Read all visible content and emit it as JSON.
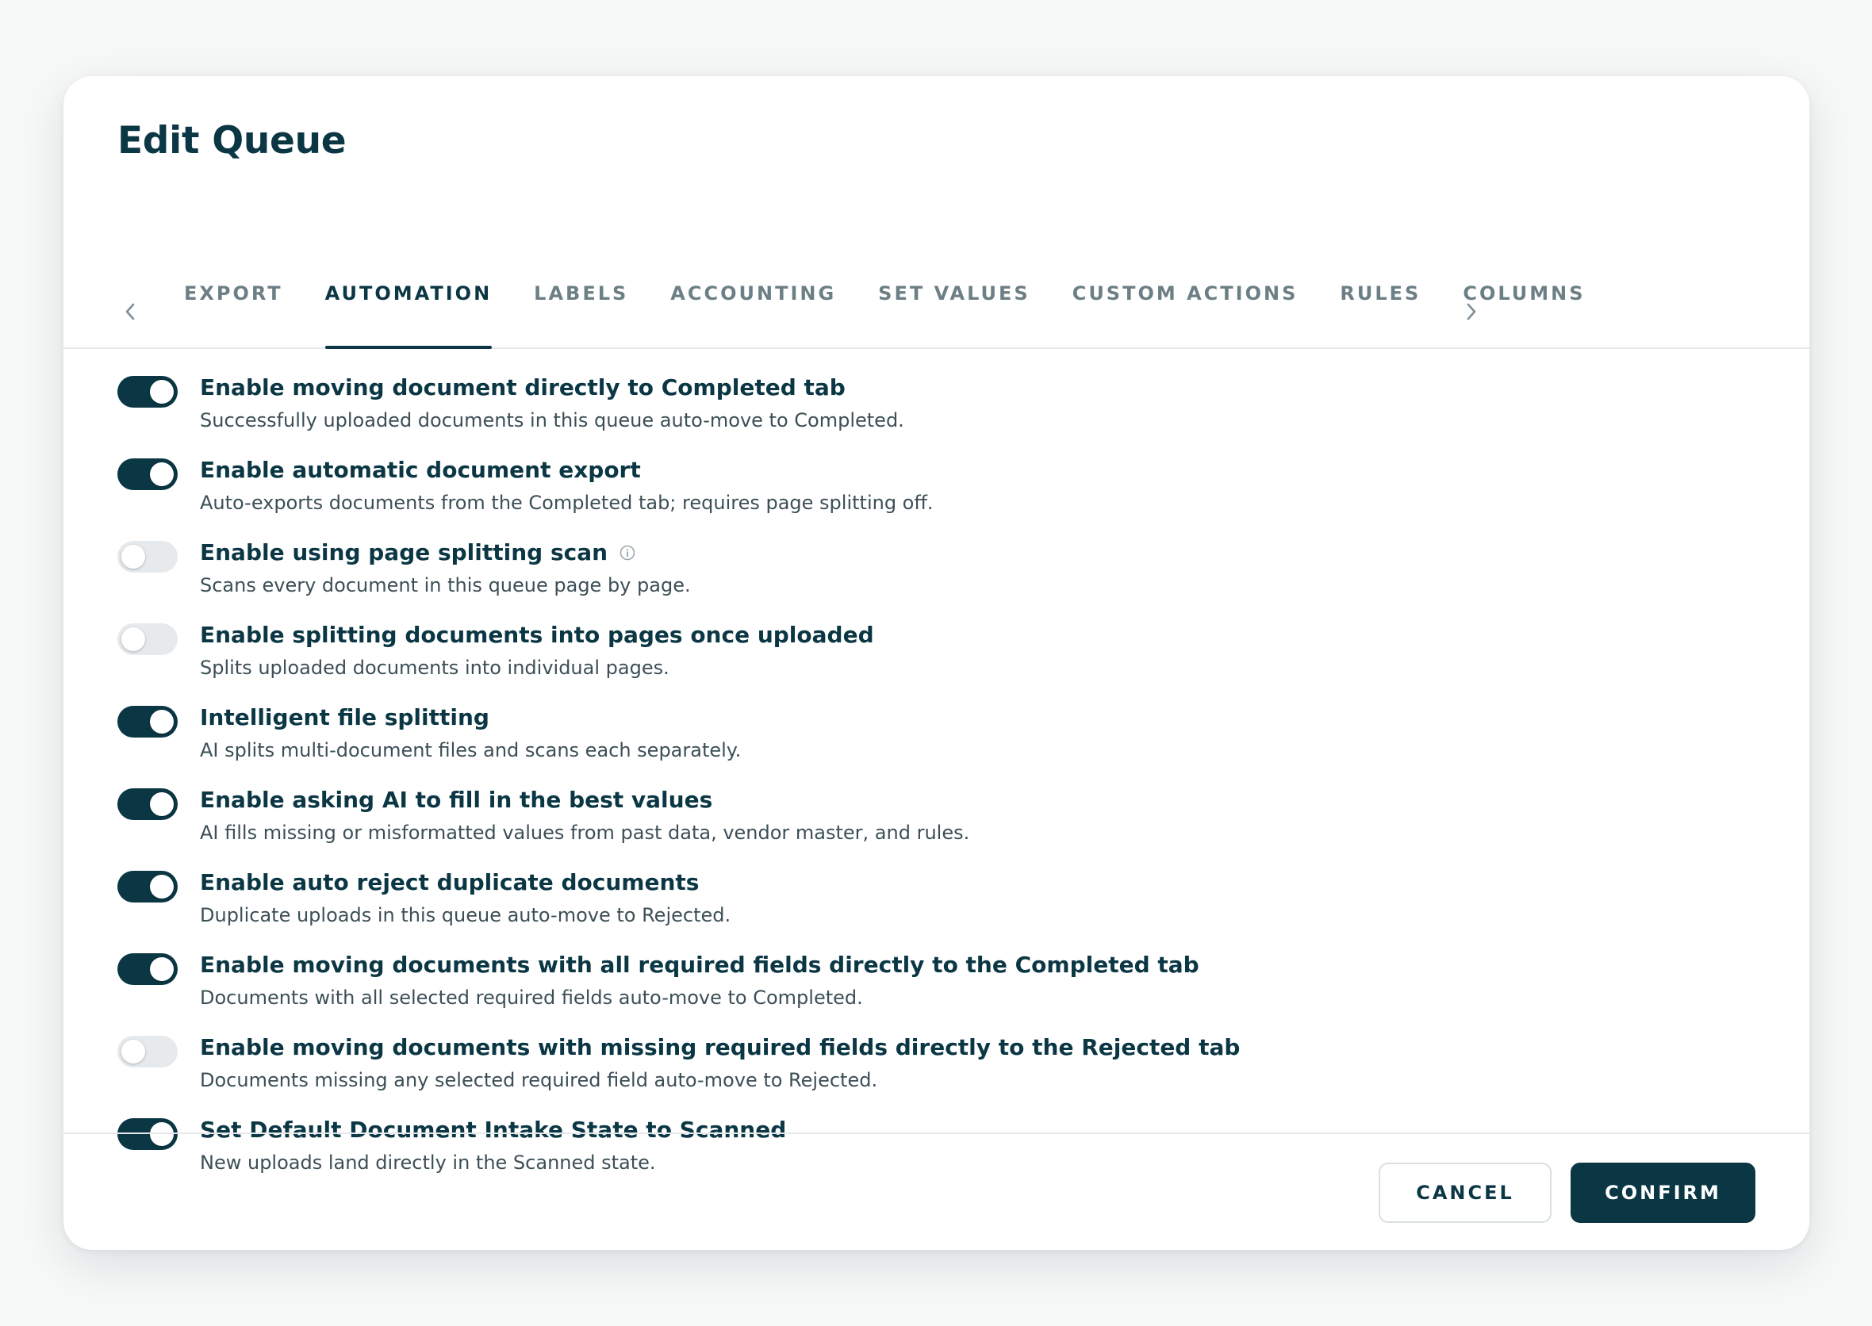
{
  "dialog": {
    "title": "Edit Queue"
  },
  "tabs": [
    {
      "label": "EXPORT",
      "active": false
    },
    {
      "label": "AUTOMATION",
      "active": true
    },
    {
      "label": "LABELS",
      "active": false
    },
    {
      "label": "ACCOUNTING",
      "active": false
    },
    {
      "label": "SET VALUES",
      "active": false
    },
    {
      "label": "CUSTOM ACTIONS",
      "active": false
    },
    {
      "label": "RULES",
      "active": false
    },
    {
      "label": "COLUMNS",
      "active": false
    }
  ],
  "nav": {
    "prev_icon": "chevron-left-icon",
    "next_icon": "chevron-right-icon"
  },
  "settings": [
    {
      "title": "Enable moving document directly to Completed tab",
      "description": "Successfully uploaded documents in this queue auto-move to Completed.",
      "enabled": true,
      "info": false
    },
    {
      "title": "Enable automatic document export",
      "description": "Auto-exports documents from the Completed tab; requires page splitting off.",
      "enabled": true,
      "info": false
    },
    {
      "title": "Enable using page splitting scan",
      "description": "Scans every document in this queue page by page.",
      "enabled": false,
      "info": true
    },
    {
      "title": "Enable splitting documents into pages once uploaded",
      "description": "Splits uploaded documents into individual pages.",
      "enabled": false,
      "info": false
    },
    {
      "title": "Intelligent file splitting",
      "description": "AI splits multi-document files and scans each separately.",
      "enabled": true,
      "info": false
    },
    {
      "title": "Enable asking AI to fill in the best values",
      "description": "AI fills missing or misformatted values from past data, vendor master, and rules.",
      "enabled": true,
      "info": false
    },
    {
      "title": "Enable auto reject duplicate documents",
      "description": "Duplicate uploads in this queue auto-move to Rejected.",
      "enabled": true,
      "info": false
    },
    {
      "title": "Enable moving documents with all required fields directly to the Completed tab",
      "description": "Documents with all selected required fields auto-move to Completed.",
      "enabled": true,
      "info": false
    },
    {
      "title": "Enable moving documents with missing required fields directly to the Rejected tab",
      "description": "Documents missing any selected required field auto-move to Rejected.",
      "enabled": false,
      "info": false
    },
    {
      "title": "Set Default Document Intake State to Scanned",
      "description": "New uploads land directly in the Scanned state.",
      "enabled": true,
      "info": false
    }
  ],
  "footer": {
    "cancel_label": "CANCEL",
    "confirm_label": "CONFIRM"
  },
  "colors": {
    "primary": "#0b3745",
    "toggle_off": "#e6eaec",
    "tab_inactive": "#6c7f85",
    "divider": "#e4e8ea"
  }
}
